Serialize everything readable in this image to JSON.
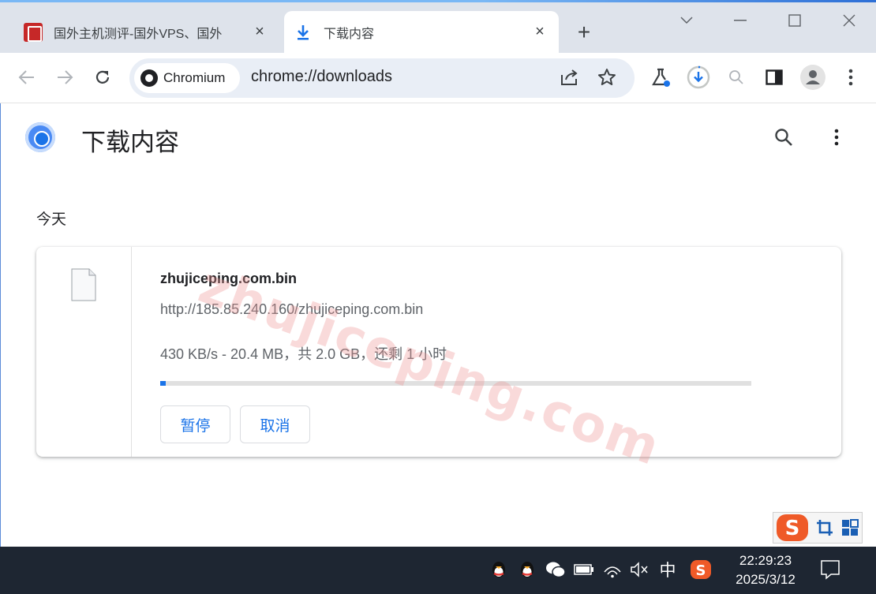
{
  "tabs": [
    {
      "title": "国外主机测评-国外VPS、国外",
      "close": "×"
    },
    {
      "title": "下载内容",
      "close": "×"
    }
  ],
  "new_tab": "+",
  "omnibox": {
    "chip_label": "Chromium",
    "url": "chrome://downloads"
  },
  "page": {
    "title": "下载内容",
    "section": "今天"
  },
  "download": {
    "filename": "zhujiceping.com.bin",
    "url": "http://185.85.240.160/zhujiceping.com.bin",
    "status": "430 KB/s - 20.4 MB，共 2.0 GB，还剩 1 小时",
    "progress": 0.01,
    "pause_label": "暂停",
    "cancel_label": "取消"
  },
  "watermark": "zhujiceping.com",
  "taskbar": {
    "ime_label": "中",
    "time": "22:29:23",
    "date": "2025/3/12"
  },
  "colors": {
    "accent": "#1a73e8",
    "tabstrip": "#dee3eb",
    "taskbar": "#1e2632"
  }
}
